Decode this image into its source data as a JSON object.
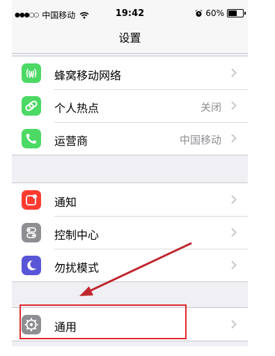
{
  "status_bar": {
    "signal_dots": "●●●○○",
    "carrier": "中国移动",
    "time": "19:42",
    "battery": "60%",
    "battery_level": 0.6
  },
  "nav": {
    "title": "设置"
  },
  "groups": [
    [
      {
        "label": "蜂窝移动网络",
        "value": "",
        "icon": "cellular-icon",
        "color": "#4cd964"
      },
      {
        "label": "个人热点",
        "value": "关闭",
        "icon": "hotspot-icon",
        "color": "#4cd964"
      },
      {
        "label": "运营商",
        "value": "中国移动",
        "icon": "phone-icon",
        "color": "#4cd964"
      }
    ],
    [
      {
        "label": "通知",
        "value": "",
        "icon": "notifications-icon",
        "color": "#ff3b30"
      },
      {
        "label": "控制中心",
        "value": "",
        "icon": "control-center-icon",
        "color": "#8e8e93"
      },
      {
        "label": "勿扰模式",
        "value": "",
        "icon": "moon-icon",
        "color": "#5856d6"
      }
    ],
    [
      {
        "label": "通用",
        "value": "",
        "icon": "gear-icon",
        "color": "#8e8e93"
      }
    ]
  ],
  "annotation": {
    "color": "#c0262d"
  }
}
